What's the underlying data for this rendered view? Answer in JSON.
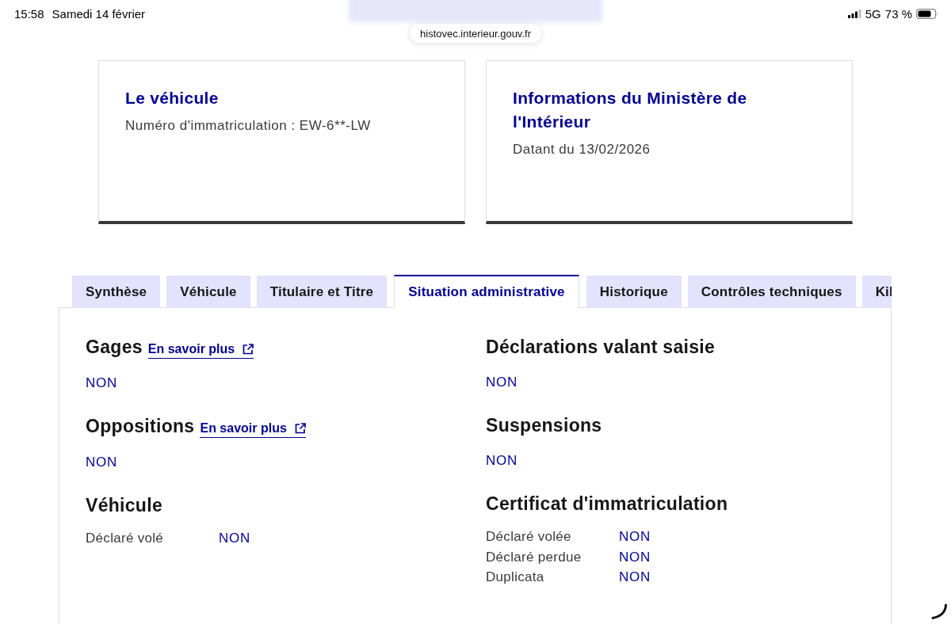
{
  "status_bar": {
    "time": "15:58",
    "date": "Samedi 14 février",
    "network": "5G",
    "battery": "73 %"
  },
  "address_bar": {
    "url": "histovec.interieur.gouv.fr"
  },
  "cards": [
    {
      "title": "Le véhicule",
      "text": "Numéro d'immatriculation : EW-6**-LW"
    },
    {
      "title": "Informations du Ministère de l'Intérieur",
      "text": "Datant du 13/02/2026"
    }
  ],
  "tabs": [
    {
      "label": "Synthèse",
      "selected": false
    },
    {
      "label": "Véhicule",
      "selected": false
    },
    {
      "label": "Titulaire et Titre",
      "selected": false
    },
    {
      "label": "Situation administrative",
      "selected": true
    },
    {
      "label": "Historique",
      "selected": false
    },
    {
      "label": "Contrôles techniques",
      "selected": false
    },
    {
      "label": "Kil",
      "selected": false
    }
  ],
  "panel": {
    "columns": [
      {
        "sections": [
          {
            "kind": "value",
            "title": "Gages",
            "link": "En savoir plus",
            "value": "NON"
          },
          {
            "kind": "value",
            "title": "Oppositions",
            "link": "En savoir plus",
            "value": "NON"
          },
          {
            "kind": "rows",
            "title": "Véhicule",
            "rows": [
              {
                "label": "Déclaré volé",
                "value": "NON"
              }
            ]
          }
        ]
      },
      {
        "sections": [
          {
            "kind": "value",
            "title": "Déclarations valant saisie",
            "value": "NON"
          },
          {
            "kind": "value",
            "title": "Suspensions",
            "value": "NON"
          },
          {
            "kind": "rows",
            "title": "Certificat d'immatriculation",
            "rows": [
              {
                "label": "Déclaré volée",
                "value": "NON"
              },
              {
                "label": "Déclaré perdue",
                "value": "NON"
              },
              {
                "label": "Duplicata",
                "value": "NON"
              }
            ]
          }
        ]
      }
    ]
  }
}
